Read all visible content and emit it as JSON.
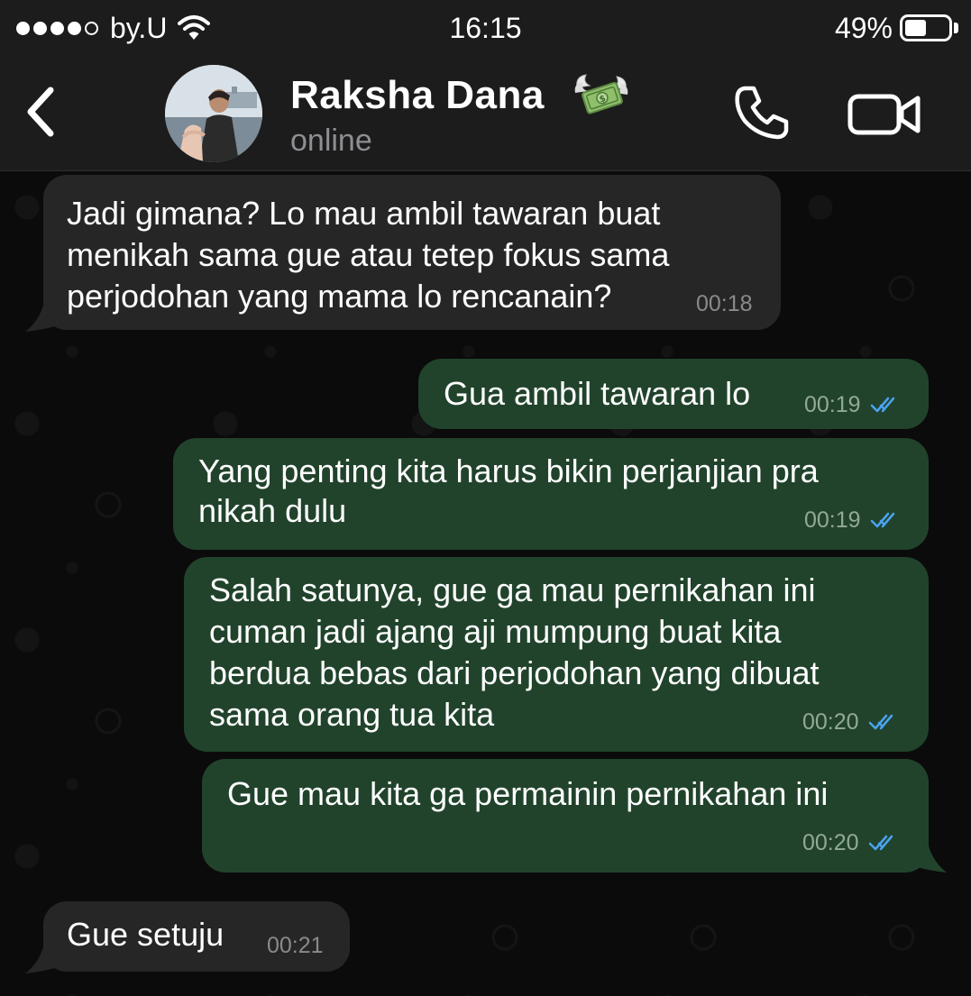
{
  "status_bar": {
    "carrier": "by.U",
    "time": "16:15",
    "battery": "49%",
    "battery_level": 0.49
  },
  "header": {
    "contact_name": "Raksha Dana",
    "contact_status": "online"
  },
  "messages": [
    {
      "direction": "incoming",
      "lines": [
        "Jadi gimana? Lo mau ambil tawaran buat",
        "menikah sama gue atau tetep fokus sama",
        "perjodohan yang mama lo rencanain?"
      ],
      "time": "00:18",
      "read": false
    },
    {
      "direction": "outgoing",
      "lines": [
        "Gua ambil tawaran lo"
      ],
      "time": "00:19",
      "read": true
    },
    {
      "direction": "outgoing",
      "lines": [
        "Yang penting kita harus bikin perjanjian pra",
        "nikah dulu"
      ],
      "time": "00:19",
      "read": true
    },
    {
      "direction": "outgoing",
      "lines": [
        "Salah satunya, gue ga mau pernikahan ini",
        "cuman jadi ajang aji mumpung buat kita",
        "berdua bebas dari perjodohan yang dibuat",
        "sama orang tua kita"
      ],
      "time": "00:20",
      "read": true
    },
    {
      "direction": "outgoing",
      "lines": [
        "Gue mau kita ga permainin pernikahan ini"
      ],
      "time": "00:20",
      "read": true
    },
    {
      "direction": "incoming",
      "lines": [
        "Gue setuju"
      ],
      "time": "00:21",
      "read": false
    }
  ],
  "colors": {
    "incoming_bubble": "#262626",
    "outgoing_bubble": "#21432c",
    "read_ticks": "#4aa3ef",
    "header_bg": "#1c1c1c"
  },
  "icons": [
    "signal-dots-icon",
    "wifi-icon",
    "battery-icon",
    "back-chevron-icon",
    "money-with-wings-icon",
    "phone-icon",
    "video-camera-icon",
    "double-check-icon"
  ]
}
